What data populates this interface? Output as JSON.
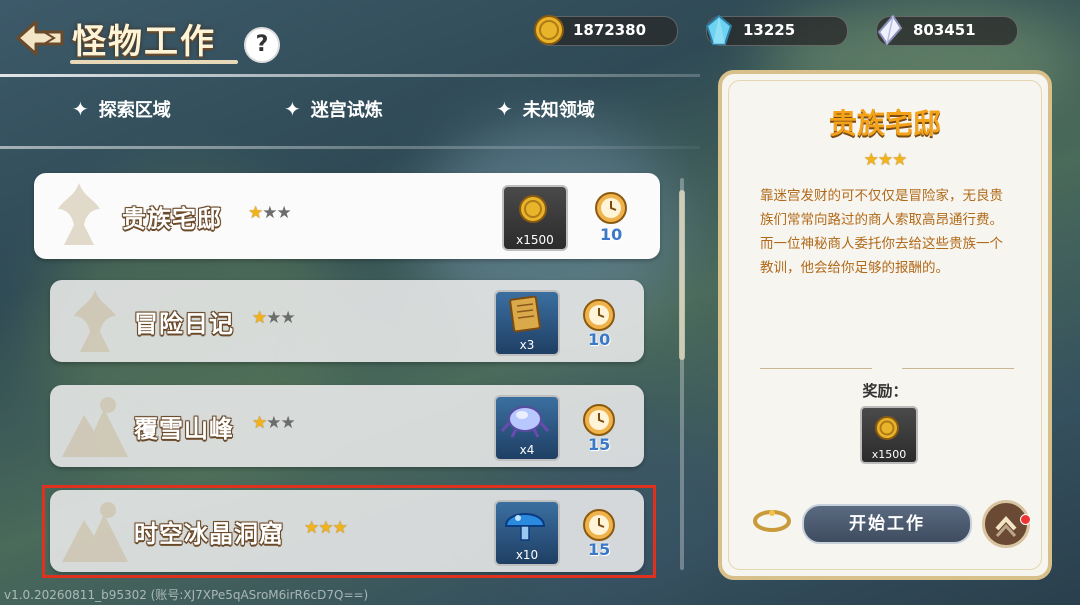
{
  "header": {
    "title": "怪物工作",
    "help_label": "?"
  },
  "currencies": [
    {
      "icon": "gold-coin-icon",
      "value": "1872380"
    },
    {
      "icon": "blue-crystal-icon",
      "value": "13225"
    },
    {
      "icon": "white-crystal-icon",
      "value": "803451"
    }
  ],
  "tabs": [
    {
      "label": "探索区域"
    },
    {
      "label": "迷宫试炼"
    },
    {
      "label": "未知领域"
    }
  ],
  "jobs": [
    {
      "name": "贵族宅邸",
      "stars": 1,
      "max_stars": 3,
      "reward_icon": "gold-coin-icon",
      "reward_qty": "x1500",
      "time": "10"
    },
    {
      "name": "冒险日记",
      "stars": 1,
      "max_stars": 3,
      "reward_icon": "scroll-icon",
      "reward_qty": "x3",
      "time": "10"
    },
    {
      "name": "覆雪山峰",
      "stars": 1,
      "max_stars": 3,
      "reward_icon": "crystal-cluster-icon",
      "reward_qty": "x4",
      "time": "15"
    },
    {
      "name": "时空冰晶洞窟",
      "stars": 3,
      "max_stars": 3,
      "reward_icon": "blue-mushroom-icon",
      "reward_qty": "x10",
      "time": "15"
    }
  ],
  "detail": {
    "title": "贵族宅邸",
    "stars": 3,
    "desc_p1": "靠迷宫发财的可不仅仅是冒险家，无良贵族们常常向路过的商人索取高昂通行费。",
    "desc_p2": "而一位神秘商人委托你去给这些贵族一个教训，他会给你足够的报酬的。",
    "reward_label": "奖励：",
    "reward_qty": "x1500",
    "start_button": "开始工作"
  },
  "footer": {
    "version": "v1.0.20260811_b95302 (账号:XJ7XPe5qASroM6irR6cD7Q==)"
  },
  "colors": {
    "star_on": "#f2b21a",
    "star_off": "#6c6c6c",
    "time": "#3a78c8",
    "highlight": "#e0301e",
    "detail_title": "#f3a21a",
    "detail_text": "#b06a1a"
  }
}
